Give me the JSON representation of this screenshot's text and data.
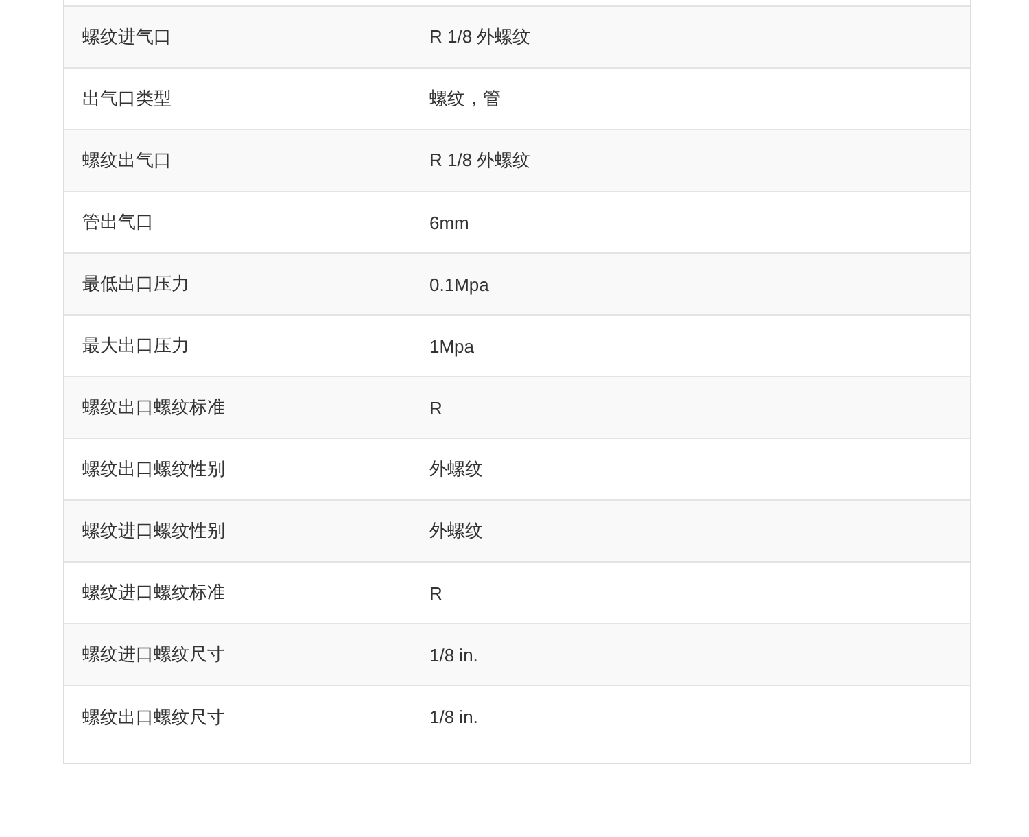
{
  "spec_table": {
    "rows": [
      {
        "label": "螺纹进气口",
        "value": "R 1/8 外螺纹"
      },
      {
        "label": "出气口类型",
        "value": "螺纹，管"
      },
      {
        "label": "螺纹出气口",
        "value": "R 1/8 外螺纹"
      },
      {
        "label": "管出气口",
        "value": "6mm"
      },
      {
        "label": "最低出口压力",
        "value": "0.1Mpa"
      },
      {
        "label": "最大出口压力",
        "value": "1Mpa"
      },
      {
        "label": "螺纹出口螺纹标准",
        "value": "R"
      },
      {
        "label": "螺纹出口螺纹性别",
        "value": "外螺纹"
      },
      {
        "label": "螺纹进口螺纹性别",
        "value": "外螺纹"
      },
      {
        "label": "螺纹进口螺纹标准",
        "value": "R"
      },
      {
        "label": "螺纹进口螺纹尺寸",
        "value": "1/8 in."
      },
      {
        "label": "螺纹出口螺纹尺寸",
        "value": "1/8 in."
      }
    ]
  }
}
